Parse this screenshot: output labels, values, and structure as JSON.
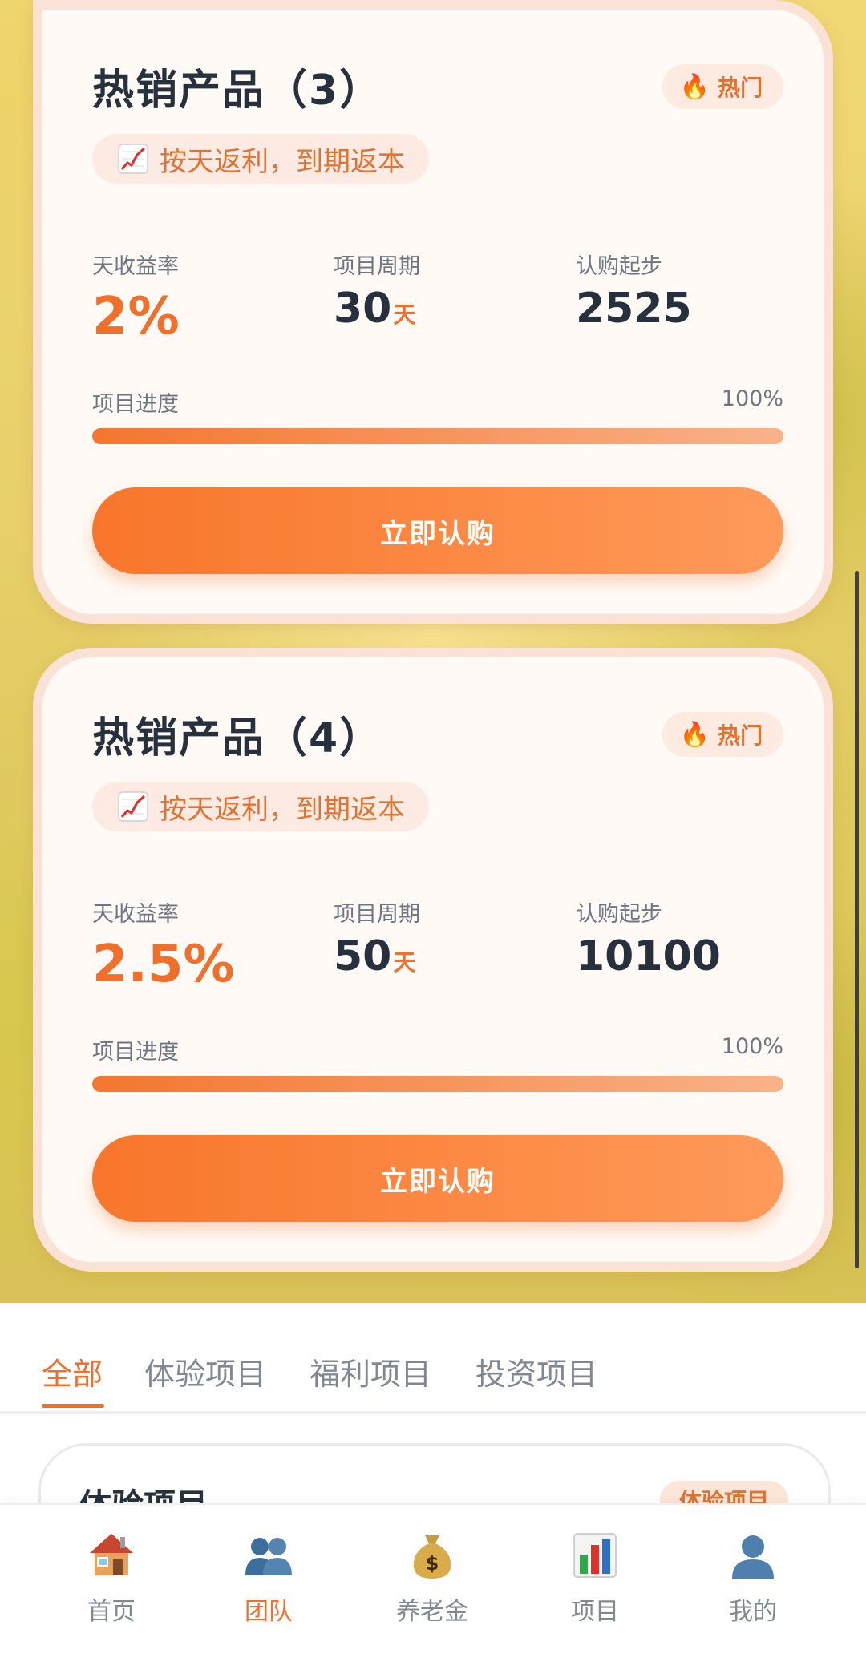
{
  "products": [
    {
      "title": "热销产品（3）",
      "badge": "热门",
      "tag": "按天返利，到期返本",
      "rate_label": "天收益率",
      "rate": "2%",
      "period_label": "项目周期",
      "period": "30",
      "period_unit": "天",
      "min_label": "认购起步",
      "min": "2525",
      "progress_label": "项目进度",
      "progress_pct": "100%",
      "progress": 100,
      "button": "立即认购"
    },
    {
      "title": "热销产品（4）",
      "badge": "热门",
      "tag": "按天返利，到期返本",
      "rate_label": "天收益率",
      "rate": "2.5%",
      "period_label": "项目周期",
      "period": "50",
      "period_unit": "天",
      "min_label": "认购起步",
      "min": "10100",
      "progress_label": "项目进度",
      "progress_pct": "100%",
      "progress": 100,
      "button": "立即认购"
    }
  ],
  "tabs": [
    {
      "label": "全部",
      "active": true
    },
    {
      "label": "体验项目",
      "active": false
    },
    {
      "label": "福利项目",
      "active": false
    },
    {
      "label": "投资项目",
      "active": false
    }
  ],
  "peek_card": {
    "title": "体验项目",
    "badge": "体验项目"
  },
  "nav": [
    {
      "label": "首页",
      "icon": "house-icon",
      "active": false
    },
    {
      "label": "团队",
      "icon": "team-icon",
      "active": true
    },
    {
      "label": "养老金",
      "icon": "money-bag-icon",
      "active": false
    },
    {
      "label": "项目",
      "icon": "bar-chart-icon",
      "active": false
    },
    {
      "label": "我的",
      "icon": "user-icon",
      "active": false
    }
  ],
  "colors": {
    "accent": "#f06f2b",
    "text": "#26313d",
    "muted": "#7f8893"
  }
}
